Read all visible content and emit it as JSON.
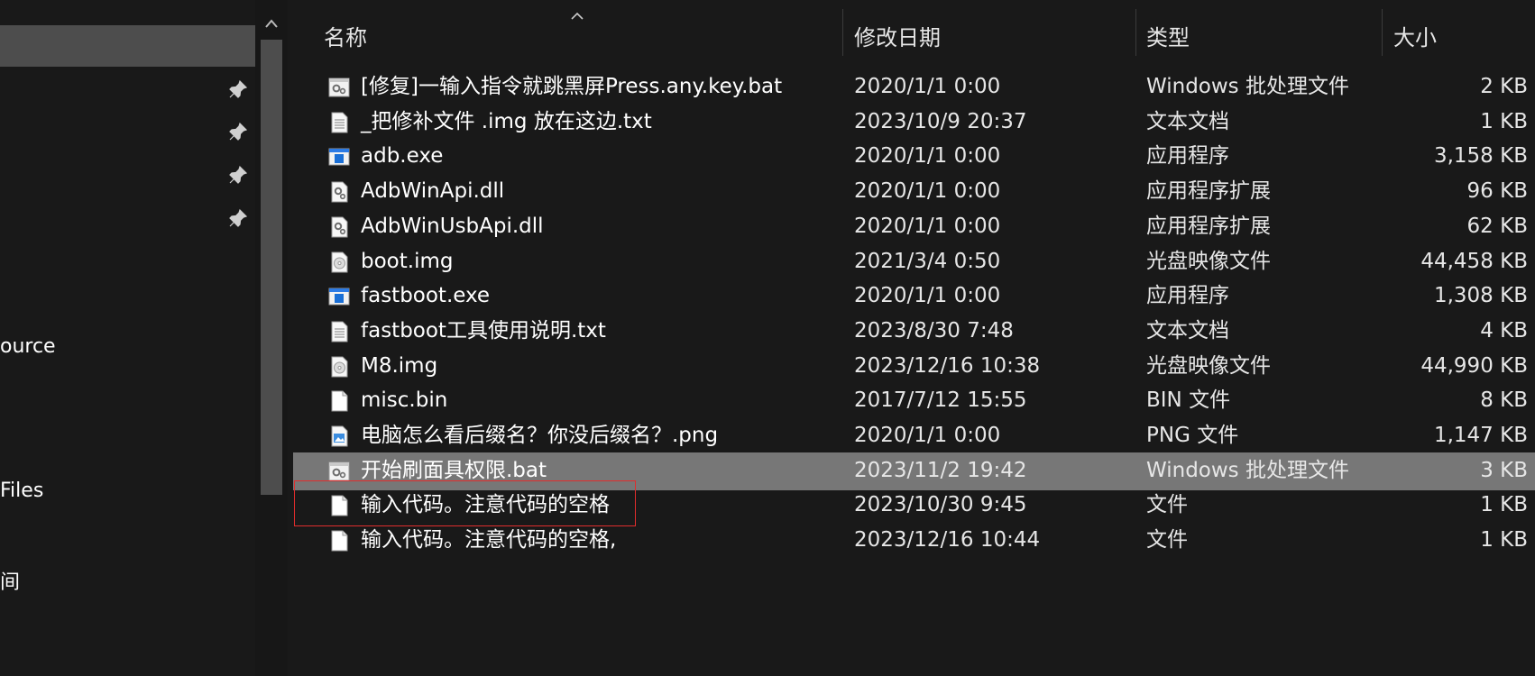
{
  "nav": {
    "pinned_count": 4,
    "labels": [
      "ource",
      " Files",
      "间"
    ]
  },
  "columns": {
    "name": "名称",
    "date": "修改日期",
    "type": "类型",
    "size": "大小"
  },
  "files": [
    {
      "name": "[修复]一输入指令就跳黑屏Press.any.key.bat",
      "date": "2020/1/1 0:00",
      "type": "Windows 批处理文件",
      "size": "2 KB",
      "icon": "batch-file-icon"
    },
    {
      "name": "_把修补文件 .img 放在这边.txt",
      "date": "2023/10/9 20:37",
      "type": "文本文档",
      "size": "1 KB",
      "icon": "text-file-icon"
    },
    {
      "name": "adb.exe",
      "date": "2020/1/1 0:00",
      "type": "应用程序",
      "size": "3,158 KB",
      "icon": "exe-file-icon"
    },
    {
      "name": "AdbWinApi.dll",
      "date": "2020/1/1 0:00",
      "type": "应用程序扩展",
      "size": "96 KB",
      "icon": "dll-file-icon"
    },
    {
      "name": "AdbWinUsbApi.dll",
      "date": "2020/1/1 0:00",
      "type": "应用程序扩展",
      "size": "62 KB",
      "icon": "dll-file-icon"
    },
    {
      "name": "boot.img",
      "date": "2021/3/4 0:50",
      "type": "光盘映像文件",
      "size": "44,458 KB",
      "icon": "disc-image-icon"
    },
    {
      "name": "fastboot.exe",
      "date": "2020/1/1 0:00",
      "type": "应用程序",
      "size": "1,308 KB",
      "icon": "exe-file-icon"
    },
    {
      "name": "fastboot工具使用说明.txt",
      "date": "2023/8/30 7:48",
      "type": "文本文档",
      "size": "4 KB",
      "icon": "text-file-icon"
    },
    {
      "name": "M8.img",
      "date": "2023/12/16 10:38",
      "type": "光盘映像文件",
      "size": "44,990 KB",
      "icon": "disc-image-icon"
    },
    {
      "name": "misc.bin",
      "date": "2017/7/12 15:55",
      "type": "BIN 文件",
      "size": "8 KB",
      "icon": "blank-file-icon"
    },
    {
      "name": "电脑怎么看后缀名？你没后缀名？.png",
      "date": "2020/1/1 0:00",
      "type": "PNG 文件",
      "size": "1,147 KB",
      "icon": "image-file-icon"
    },
    {
      "name": "开始刷面具权限.bat",
      "date": "2023/11/2 19:42",
      "type": "Windows 批处理文件",
      "size": "3 KB",
      "icon": "batch-file-icon",
      "selected": true
    },
    {
      "name": "输入代码。注意代码的空格",
      "date": "2023/10/30 9:45",
      "type": "文件",
      "size": "1 KB",
      "icon": "blank-file-icon"
    },
    {
      "name": "输入代码。注意代码的空格,",
      "date": "2023/12/16 10:44",
      "type": "文件",
      "size": "1 KB",
      "icon": "blank-file-icon"
    }
  ],
  "colors": {
    "background": "#191919",
    "selection": "#777777",
    "nav_selection": "#4d4d4d",
    "highlight_box": "#e12d2d"
  }
}
